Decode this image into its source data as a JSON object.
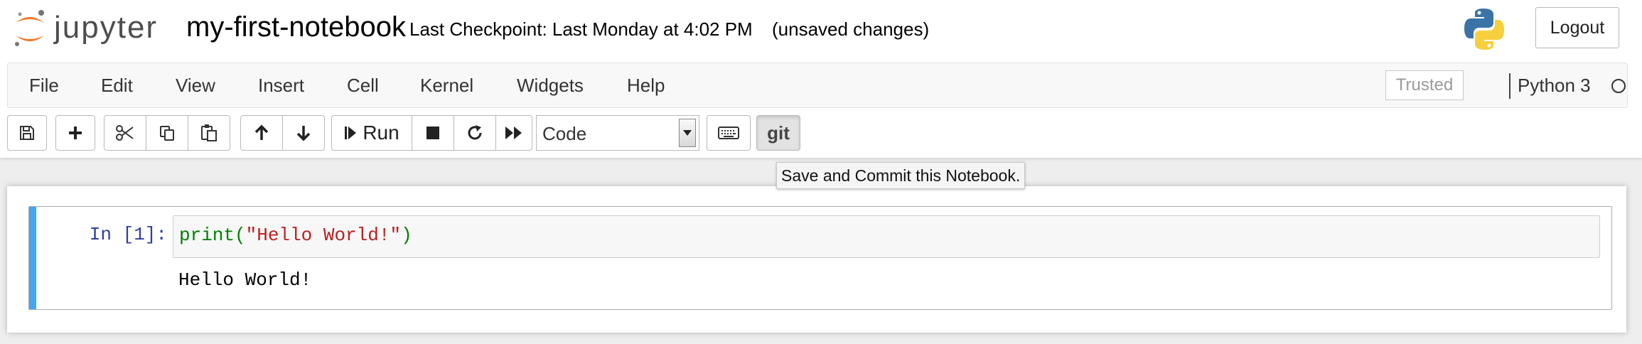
{
  "header": {
    "logo_text": "jupyter",
    "notebook_name": "my-first-notebook",
    "checkpoint": "Last Checkpoint: Last Monday at 4:02 PM",
    "autosave_status": "(unsaved changes)",
    "logout_label": "Logout"
  },
  "menubar": {
    "items": [
      "File",
      "Edit",
      "View",
      "Insert",
      "Cell",
      "Kernel",
      "Widgets",
      "Help"
    ],
    "trusted_label": "Trusted",
    "kernel_name": "Python 3"
  },
  "toolbar": {
    "run_label": "Run",
    "cell_type": "Code",
    "git_label": "git",
    "tooltip": "Save and Commit this Notebook."
  },
  "cell": {
    "prompt": "In [1]:",
    "code_fn": "print",
    "code_open": "(",
    "code_string": "\"Hello World!\"",
    "code_close": ")",
    "output": "Hello World!"
  },
  "colors": {
    "cell_selected_bar": "#42a5f5",
    "prompt": "#303f9f",
    "code_builtin": "#008000",
    "code_string": "#ba2121"
  }
}
